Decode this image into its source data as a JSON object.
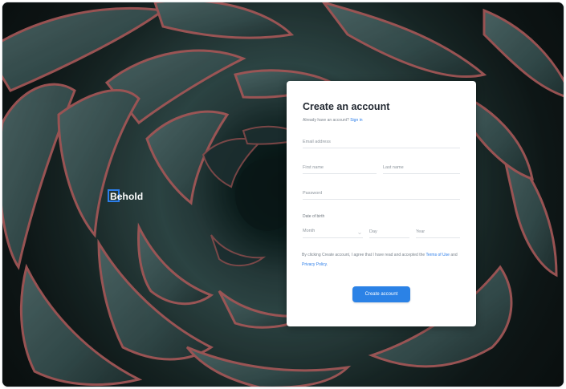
{
  "brand": {
    "logo_text": "Behold",
    "accent_color": "#2b7de9"
  },
  "form": {
    "title": "Create an account",
    "subtitle_text": "Already have an account?",
    "signin_link": "Sign in",
    "email": {
      "placeholder": "Email address",
      "value": ""
    },
    "first_name": {
      "placeholder": "First name",
      "value": ""
    },
    "last_name": {
      "placeholder": "Last name",
      "value": ""
    },
    "password": {
      "placeholder": "Password",
      "value": ""
    },
    "dob_label": "Date of birth",
    "month": {
      "placeholder": "Month",
      "icon": "chevron-down-icon"
    },
    "day": {
      "placeholder": "Day",
      "value": ""
    },
    "year": {
      "placeholder": "Year",
      "value": ""
    },
    "terms": {
      "prefix": "By clicking Create account, I agree that I have read and accepted the",
      "terms_link": "Terms of Use",
      "and": "and",
      "privacy_link": "Privacy Policy",
      "suffix": "."
    },
    "submit_label": "Create account",
    "button_color": "#2b82e6"
  }
}
